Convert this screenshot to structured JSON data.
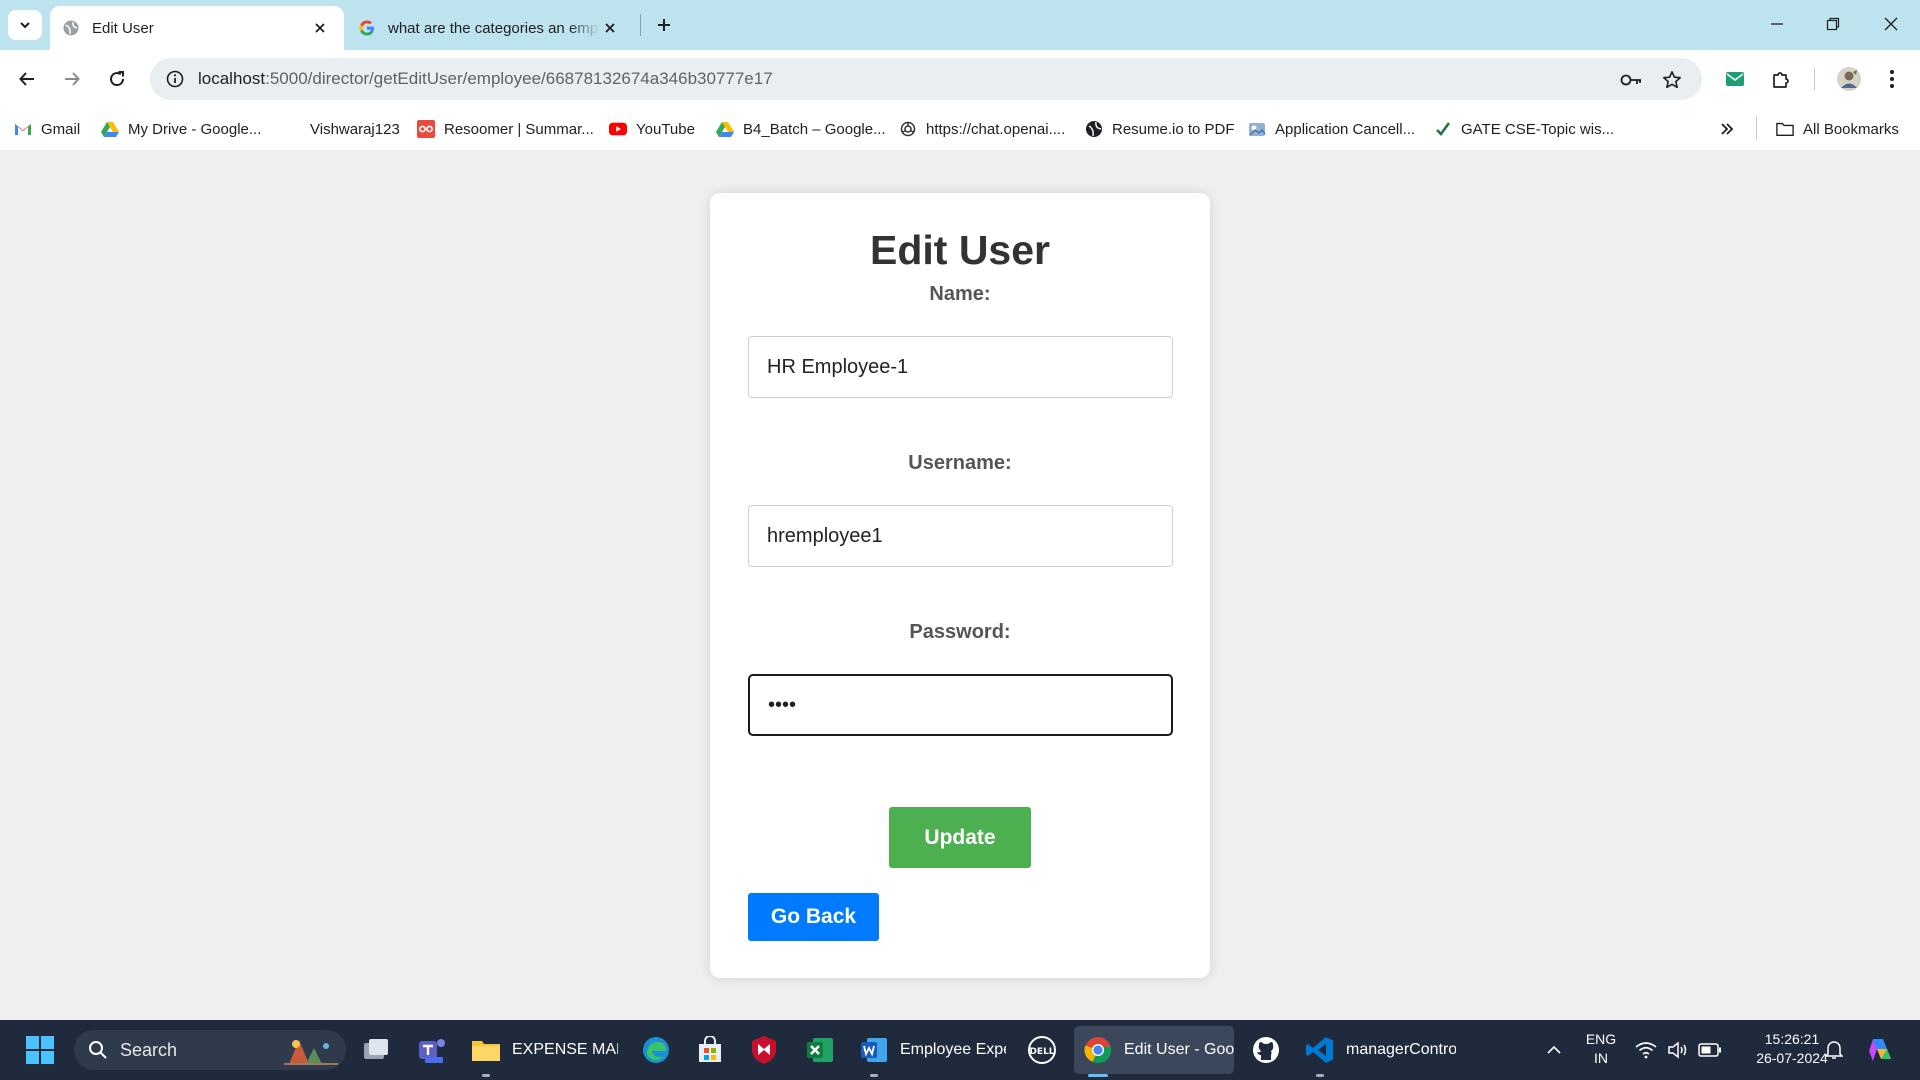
{
  "browser": {
    "tabs": [
      {
        "title": "Edit User",
        "active": true
      },
      {
        "title": "what are the categories an emp",
        "active": false
      }
    ],
    "url": {
      "host": "localhost",
      "path": ":5000/director/getEditUser/employee/66878132674a346b30777e17"
    },
    "bookmarks": [
      {
        "label": "Gmail",
        "icon": "gmail-icon"
      },
      {
        "label": "My Drive - Google...",
        "icon": "google-drive-icon"
      },
      {
        "label": "Vishwaraj123",
        "icon": "blank-icon"
      },
      {
        "label": "Resoomer | Summar...",
        "icon": "resoomer-icon"
      },
      {
        "label": "YouTube",
        "icon": "youtube-icon"
      },
      {
        "label": "B4_Batch – Google...",
        "icon": "google-drive-icon"
      },
      {
        "label": "https://chat.openai....",
        "icon": "openai-icon"
      },
      {
        "label": "Resume.io to PDF",
        "icon": "globe-icon"
      },
      {
        "label": "Application Cancell...",
        "icon": "app-icon"
      },
      {
        "label": "GATE CSE-Topic wis...",
        "icon": "check-icon"
      }
    ],
    "all_bookmarks": "All Bookmarks"
  },
  "form": {
    "title": "Edit User",
    "name_label": "Name:",
    "name_value": "HR Employee-1",
    "username_label": "Username:",
    "username_value": "hremployee1",
    "password_label": "Password:",
    "password_value": "••••",
    "update_label": "Update",
    "back_label": "Go Back"
  },
  "taskbar": {
    "search_label": "Search",
    "apps": [
      {
        "label": "EXPENSE MANA",
        "icon": "file-explorer-icon"
      },
      {
        "label": "Employee Expe",
        "icon": "word-icon"
      },
      {
        "label": "Edit User - Goo",
        "icon": "chrome-icon"
      },
      {
        "label": "managerContro",
        "icon": "vscode-icon"
      }
    ],
    "lang_top": "ENG",
    "lang_bottom": "IN",
    "time": "15:26:21",
    "date": "26-07-2024"
  },
  "colors": {
    "tabbar": "#bde3ee",
    "update_button": "#4caf50",
    "back_button": "#007bff",
    "taskbar": "#1f2a3c"
  }
}
